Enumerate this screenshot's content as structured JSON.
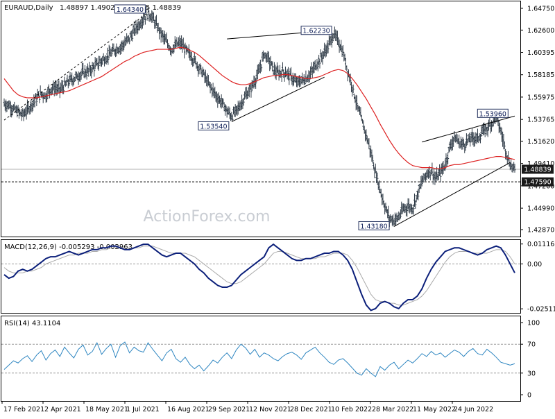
{
  "header": {
    "symbol": "EURAUD,Daily",
    "ohlc": "1.48897 1.49022 1.48015 1.48839"
  },
  "watermark": "ActionForex.com",
  "colors": {
    "background": "#ffffff",
    "bars": "#2e3a46",
    "sma": "#dd2222",
    "macd": "#0b1f7a",
    "signal": "#aaaaaa",
    "rsi": "#2e86c1",
    "trendline": "#000000",
    "label_border": "#1f2d5a",
    "price_tag": "#1a1a1a"
  },
  "chart_data": [
    {
      "type": "ohlc-bars-with-moving-average",
      "panel": "price",
      "series": [
        {
          "name": "EURAUD",
          "values": [
            1.553,
            1.552,
            1.548,
            1.545,
            1.542,
            1.547,
            1.553,
            1.559,
            1.563,
            1.561,
            1.568,
            1.569,
            1.567,
            1.571,
            1.576,
            1.578,
            1.581,
            1.584,
            1.585,
            1.588,
            1.592,
            1.596,
            1.599,
            1.603,
            1.607,
            1.609,
            1.613,
            1.618,
            1.625,
            1.631,
            1.638,
            1.643,
            1.638,
            1.629,
            1.621,
            1.614,
            1.607,
            1.611,
            1.613,
            1.607,
            1.602,
            1.596,
            1.589,
            1.582,
            1.573,
            1.566,
            1.559,
            1.554,
            1.546,
            1.541,
            1.546,
            1.553,
            1.561,
            1.567,
            1.576,
            1.586,
            1.603,
            1.597,
            1.587,
            1.583,
            1.585,
            1.583,
            1.579,
            1.574,
            1.576,
            1.578,
            1.583,
            1.59,
            1.597,
            1.604,
            1.612,
            1.622,
            1.615,
            1.604,
            1.586,
            1.57,
            1.552,
            1.537,
            1.522,
            1.505,
            1.485,
            1.468,
            1.452,
            1.44,
            1.438,
            1.441,
            1.449,
            1.452,
            1.45,
            1.463,
            1.476,
            1.484,
            1.487,
            1.479,
            1.485,
            1.493,
            1.51,
            1.52,
            1.515,
            1.513,
            1.517,
            1.52,
            1.519,
            1.525,
            1.529,
            1.534,
            1.54,
            1.526,
            1.508,
            1.493,
            1.488
          ]
        },
        {
          "name": "SMA",
          "values": [
            1.578,
            1.572,
            1.566,
            1.562,
            1.56,
            1.559,
            1.559,
            1.559,
            1.56,
            1.561,
            1.562,
            1.563,
            1.564,
            1.565,
            1.566,
            1.568,
            1.57,
            1.572,
            1.574,
            1.576,
            1.578,
            1.58,
            1.583,
            1.586,
            1.589,
            1.592,
            1.595,
            1.597,
            1.6,
            1.602,
            1.604,
            1.605,
            1.606,
            1.607,
            1.607,
            1.607,
            1.607,
            1.608,
            1.609,
            1.608,
            1.606,
            1.604,
            1.601,
            1.597,
            1.593,
            1.589,
            1.585,
            1.581,
            1.578,
            1.575,
            1.573,
            1.572,
            1.572,
            1.573,
            1.575,
            1.577,
            1.579,
            1.58,
            1.581,
            1.581,
            1.582,
            1.582,
            1.581,
            1.58,
            1.579,
            1.578,
            1.578,
            1.579,
            1.58,
            1.582,
            1.584,
            1.586,
            1.587,
            1.586,
            1.583,
            1.578,
            1.572,
            1.565,
            1.558,
            1.55,
            1.542,
            1.533,
            1.525,
            1.517,
            1.51,
            1.504,
            1.499,
            1.495,
            1.492,
            1.491,
            1.49,
            1.49,
            1.49,
            1.489,
            1.489,
            1.49,
            1.492,
            1.493,
            1.493,
            1.494,
            1.495,
            1.496,
            1.497,
            1.498,
            1.499,
            1.5,
            1.501,
            1.501,
            1.5,
            1.499,
            1.498
          ]
        }
      ],
      "y_ticks": [
        "1.64750",
        "1.62600",
        "1.60395",
        "1.58185",
        "1.55975",
        "1.53765",
        "1.51620",
        "1.49410",
        "1.47200",
        "1.44990",
        "1.42870"
      ],
      "ylim": [
        1.4287,
        1.6475
      ],
      "annotations": [
        {
          "label": "1.64340",
          "value": 1.6434
        },
        {
          "label": "1.62230",
          "value": 1.6223
        },
        {
          "label": "1.53540",
          "value": 1.5354
        },
        {
          "label": "1.53960",
          "value": 1.5396
        },
        {
          "label": "1.43180",
          "value": 1.4318
        }
      ],
      "price_tags": [
        "1.48839",
        "1.47590"
      ]
    },
    {
      "type": "line",
      "panel": "macd",
      "title": "MACD(12,26,9) -0.005293 -0.002963",
      "y_ticks": [
        "0.011168",
        "0.00",
        "-0.025117"
      ],
      "ylim": [
        -0.027,
        0.013
      ],
      "series": [
        {
          "name": "MACD",
          "values": [
            -0.006,
            -0.008,
            -0.007,
            -0.004,
            -0.003,
            -0.004,
            -0.003,
            -0.001,
            0.001,
            0.003,
            0.004,
            0.004,
            0.005,
            0.006,
            0.007,
            0.006,
            0.005,
            0.006,
            0.007,
            0.008,
            0.008,
            0.009,
            0.009,
            0.01,
            0.01,
            0.009,
            0.008,
            0.008,
            0.009,
            0.01,
            0.011,
            0.011,
            0.009,
            0.007,
            0.005,
            0.004,
            0.005,
            0.006,
            0.006,
            0.004,
            0.002,
            0.0,
            -0.003,
            -0.005,
            -0.008,
            -0.01,
            -0.012,
            -0.013,
            -0.013,
            -0.012,
            -0.009,
            -0.006,
            -0.004,
            -0.002,
            0.0,
            0.002,
            0.004,
            0.009,
            0.011,
            0.009,
            0.007,
            0.005,
            0.003,
            0.002,
            0.002,
            0.003,
            0.003,
            0.004,
            0.005,
            0.006,
            0.006,
            0.007,
            0.007,
            0.005,
            0.002,
            -0.003,
            -0.01,
            -0.017,
            -0.023,
            -0.026,
            -0.025,
            -0.022,
            -0.021,
            -0.022,
            -0.024,
            -0.025,
            -0.022,
            -0.02,
            -0.02,
            -0.018,
            -0.014,
            -0.008,
            -0.003,
            0.001,
            0.004,
            0.007,
            0.008,
            0.009,
            0.009,
            0.008,
            0.007,
            0.006,
            0.005,
            0.006,
            0.008,
            0.009,
            0.01,
            0.009,
            0.005,
            0.0,
            -0.005
          ]
        },
        {
          "name": "Signal",
          "values": [
            -0.002,
            -0.004,
            -0.005,
            -0.005,
            -0.005,
            -0.004,
            -0.004,
            -0.003,
            -0.002,
            0.0,
            0.001,
            0.002,
            0.003,
            0.004,
            0.005,
            0.005,
            0.006,
            0.006,
            0.006,
            0.007,
            0.007,
            0.008,
            0.008,
            0.009,
            0.009,
            0.009,
            0.009,
            0.009,
            0.009,
            0.009,
            0.01,
            0.01,
            0.01,
            0.009,
            0.008,
            0.007,
            0.006,
            0.006,
            0.006,
            0.006,
            0.005,
            0.004,
            0.002,
            0.0,
            -0.002,
            -0.004,
            -0.006,
            -0.008,
            -0.01,
            -0.011,
            -0.011,
            -0.01,
            -0.008,
            -0.006,
            -0.004,
            -0.002,
            0.0,
            0.003,
            0.006,
            0.007,
            0.007,
            0.006,
            0.005,
            0.004,
            0.003,
            0.003,
            0.003,
            0.003,
            0.004,
            0.004,
            0.005,
            0.006,
            0.006,
            0.006,
            0.005,
            0.002,
            -0.002,
            -0.007,
            -0.012,
            -0.017,
            -0.02,
            -0.021,
            -0.021,
            -0.022,
            -0.022,
            -0.023,
            -0.023,
            -0.022,
            -0.021,
            -0.02,
            -0.018,
            -0.015,
            -0.011,
            -0.007,
            -0.003,
            0.001,
            0.004,
            0.006,
            0.007,
            0.007,
            0.007,
            0.006,
            0.006,
            0.006,
            0.006,
            0.007,
            0.008,
            0.008,
            0.007,
            0.004,
            0.0
          ]
        }
      ]
    },
    {
      "type": "line",
      "panel": "rsi",
      "title": "RSI(14) 43.1104",
      "y_ticks": [
        "100",
        "70",
        "30",
        "0"
      ],
      "ylim": [
        0,
        100
      ],
      "series": [
        {
          "name": "RSI",
          "values": [
            35,
            41,
            47,
            44,
            50,
            54,
            46,
            55,
            61,
            48,
            57,
            62,
            53,
            66,
            58,
            51,
            63,
            69,
            55,
            60,
            72,
            56,
            64,
            70,
            52,
            68,
            73,
            58,
            66,
            61,
            59,
            72,
            63,
            55,
            47,
            58,
            63,
            50,
            45,
            52,
            42,
            36,
            41,
            33,
            40,
            48,
            44,
            52,
            58,
            50,
            62,
            70,
            65,
            56,
            63,
            52,
            58,
            55,
            50,
            47,
            53,
            57,
            59,
            55,
            49,
            58,
            62,
            66,
            58,
            52,
            45,
            42,
            48,
            50,
            44,
            37,
            30,
            27,
            36,
            30,
            25,
            39,
            34,
            41,
            45,
            36,
            42,
            48,
            44,
            50,
            57,
            53,
            60,
            55,
            58,
            52,
            57,
            62,
            59,
            53,
            60,
            64,
            57,
            55,
            63,
            58,
            52,
            45,
            43,
            41,
            43
          ]
        }
      ]
    }
  ],
  "x_axis": {
    "ticks": [
      "17 Feb 2021",
      "2 Apr 2021",
      "18 May 2021",
      "1 Jul 2021",
      "16 Aug 2021",
      "29 Sep 2021",
      "12 Nov 2021",
      "28 Dec 2021",
      "10 Feb 2022",
      "28 Mar 2022",
      "11 May 2022",
      "24 Jun 2022"
    ]
  }
}
